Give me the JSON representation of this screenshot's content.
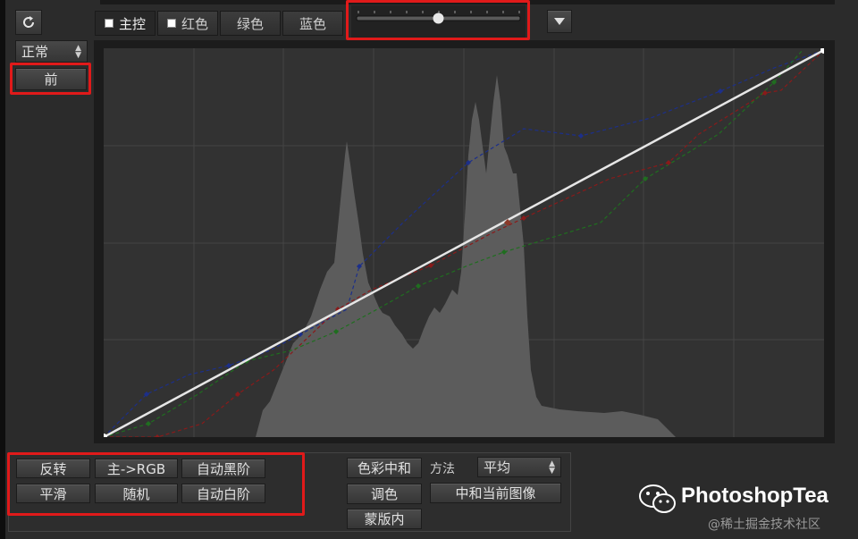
{
  "toolbar": {
    "reset_icon": "refresh-icon",
    "tabs": [
      {
        "label": "主控",
        "checked": true
      },
      {
        "label": "红色",
        "checked": true
      },
      {
        "label": "绿色",
        "checked": false
      },
      {
        "label": "蓝色",
        "checked": false
      }
    ],
    "slider_value": 0.5,
    "menu_icon": "triangle-down-icon"
  },
  "left": {
    "mode_select": "正常",
    "before_button": "前"
  },
  "curve_colors": {
    "master": "#e6e6e6",
    "red": "#8a1a1a",
    "green": "#1f6e1f",
    "blue": "#1c2f8a",
    "histogram": "#5c5c5c",
    "highlight_box": "#e01a1a"
  },
  "bottom": {
    "buttons_left": [
      [
        "反转",
        "主->RGB",
        "自动黑阶"
      ],
      [
        "平滑",
        "随机",
        "自动白阶"
      ]
    ],
    "buttons_mid": [
      "色彩中和",
      "调色",
      "蒙版内"
    ],
    "method_label": "方法",
    "method_select": "平均",
    "neutralize_button": "中和当前图像"
  },
  "watermark": {
    "brand": "PhotoshopTea",
    "site": "@稀土掘金技术社区"
  }
}
